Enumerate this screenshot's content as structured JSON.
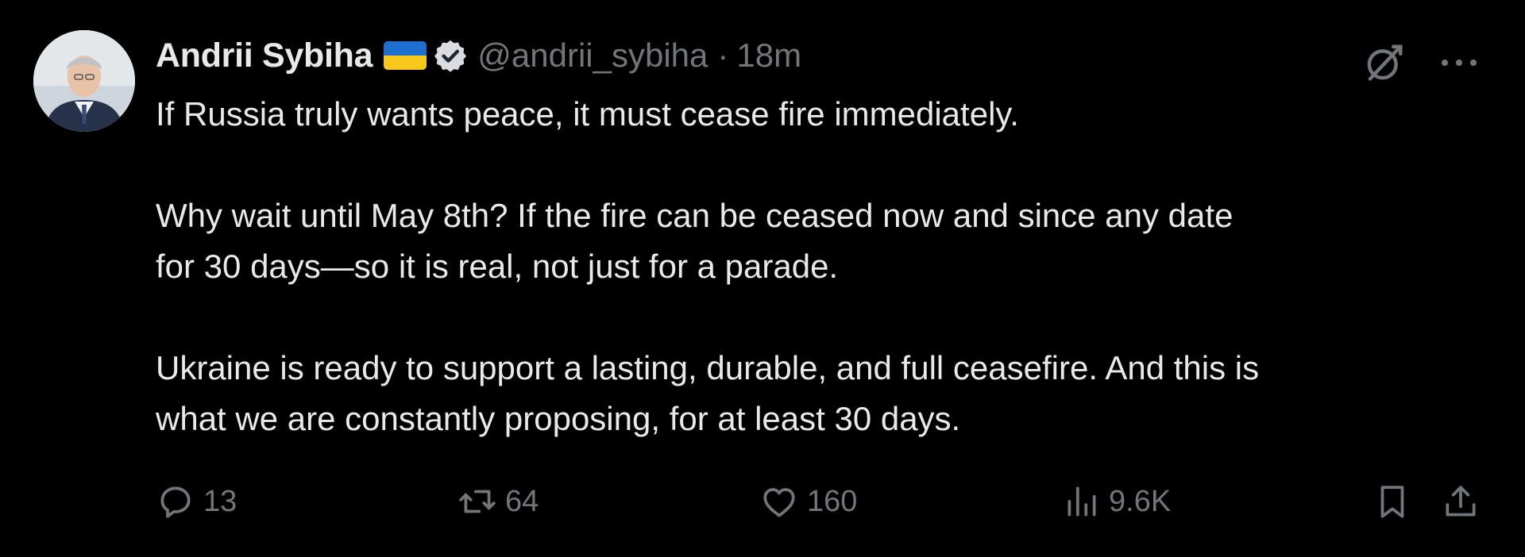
{
  "author": {
    "name": "Andrii Sybiha",
    "handle": "@andrii_sybiha",
    "separator": "·",
    "time": "18m",
    "flag": "ukraine-flag",
    "verified_icon": "verified-badge-icon"
  },
  "tweet": {
    "paragraphs": [
      "If Russia truly wants peace, it must cease fire immediately.",
      "Why wait until May 8th? If the fire can be ceased now and since any date\nfor 30 days—so it is real, not just for a parade.",
      "Ukraine is ready to support a lasting, durable, and full ceasefire. And this is\nwhat we are constantly proposing, for at least 30 days."
    ]
  },
  "actions": {
    "replies": "13",
    "reposts": "64",
    "likes": "160",
    "views": "9.6K"
  },
  "icons": {
    "top": [
      "grok-icon",
      "more-icon"
    ],
    "actions": [
      "reply-icon",
      "repost-icon",
      "like-icon",
      "views-icon",
      "bookmark-icon",
      "share-icon"
    ]
  },
  "colors": {
    "background": "#000000",
    "text": "#e7e9ea",
    "muted": "#71767b",
    "flag_blue": "#1f6fd1",
    "flag_yellow": "#f8c91a",
    "verified": "#d9dde2"
  }
}
